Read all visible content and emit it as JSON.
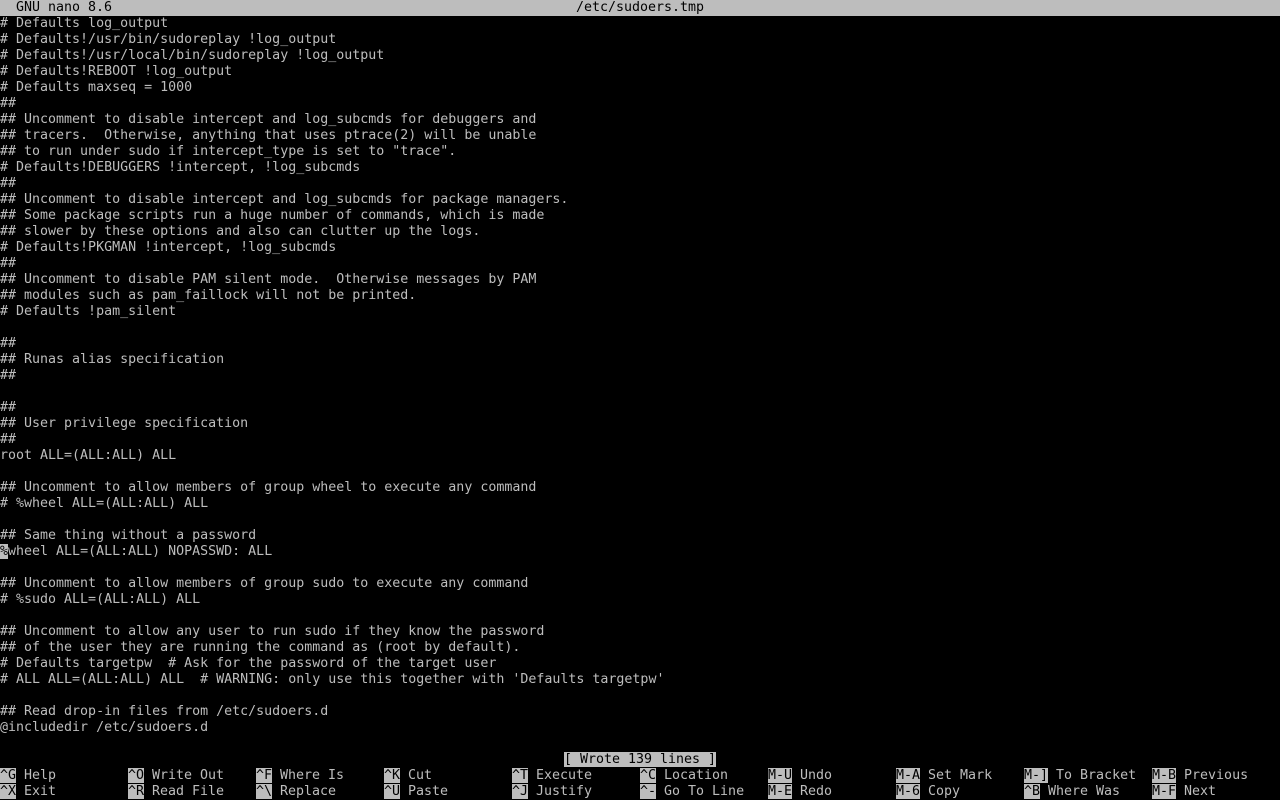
{
  "titlebar": {
    "app": "GNU nano 8.6",
    "filename": "/etc/sudoers.tmp"
  },
  "editor": {
    "lines": [
      "# Defaults log_output",
      "# Defaults!/usr/bin/sudoreplay !log_output",
      "# Defaults!/usr/local/bin/sudoreplay !log_output",
      "# Defaults!REBOOT !log_output",
      "# Defaults maxseq = 1000",
      "##",
      "## Uncomment to disable intercept and log_subcmds for debuggers and",
      "## tracers.  Otherwise, anything that uses ptrace(2) will be unable",
      "## to run under sudo if intercept_type is set to \"trace\".",
      "# Defaults!DEBUGGERS !intercept, !log_subcmds",
      "##",
      "## Uncomment to disable intercept and log_subcmds for package managers.",
      "## Some package scripts run a huge number of commands, which is made",
      "## slower by these options and also can clutter up the logs.",
      "# Defaults!PKGMAN !intercept, !log_subcmds",
      "##",
      "## Uncomment to disable PAM silent mode.  Otherwise messages by PAM",
      "## modules such as pam_faillock will not be printed.",
      "# Defaults !pam_silent",
      "",
      "##",
      "## Runas alias specification",
      "##",
      "",
      "##",
      "## User privilege specification",
      "##",
      "root ALL=(ALL:ALL) ALL",
      "",
      "## Uncomment to allow members of group wheel to execute any command",
      "# %wheel ALL=(ALL:ALL) ALL",
      "",
      "## Same thing without a password",
      "%wheel ALL=(ALL:ALL) NOPASSWD: ALL",
      "",
      "## Uncomment to allow members of group sudo to execute any command",
      "# %sudo ALL=(ALL:ALL) ALL",
      "",
      "## Uncomment to allow any user to run sudo if they know the password",
      "## of the user they are running the command as (root by default).",
      "# Defaults targetpw  # Ask for the password of the target user",
      "# ALL ALL=(ALL:ALL) ALL  # WARNING: only use this together with 'Defaults targetpw'",
      "",
      "## Read drop-in files from /etc/sudoers.d",
      "@includedir /etc/sudoers.d"
    ],
    "cursor_line": 33
  },
  "status": {
    "message": "[ Wrote 139 lines ]"
  },
  "shortcuts": [
    {
      "key": "^G",
      "label": "Help"
    },
    {
      "key": "^X",
      "label": "Exit"
    },
    {
      "key": "^O",
      "label": "Write Out"
    },
    {
      "key": "^R",
      "label": "Read File"
    },
    {
      "key": "^F",
      "label": "Where Is"
    },
    {
      "key": "^\\",
      "label": "Replace"
    },
    {
      "key": "^K",
      "label": "Cut"
    },
    {
      "key": "^U",
      "label": "Paste"
    },
    {
      "key": "^T",
      "label": "Execute"
    },
    {
      "key": "^J",
      "label": "Justify"
    },
    {
      "key": "^C",
      "label": "Location"
    },
    {
      "key": "^-",
      "label": "Go To Line"
    },
    {
      "key": "M-U",
      "label": "Undo"
    },
    {
      "key": "M-E",
      "label": "Redo"
    },
    {
      "key": "M-A",
      "label": "Set Mark"
    },
    {
      "key": "M-6",
      "label": "Copy"
    },
    {
      "key": "M-]",
      "label": "To Bracket"
    },
    {
      "key": "^B",
      "label": "Where Was"
    },
    {
      "key": "M-B",
      "label": "Previous"
    },
    {
      "key": "M-F",
      "label": "Next"
    }
  ]
}
